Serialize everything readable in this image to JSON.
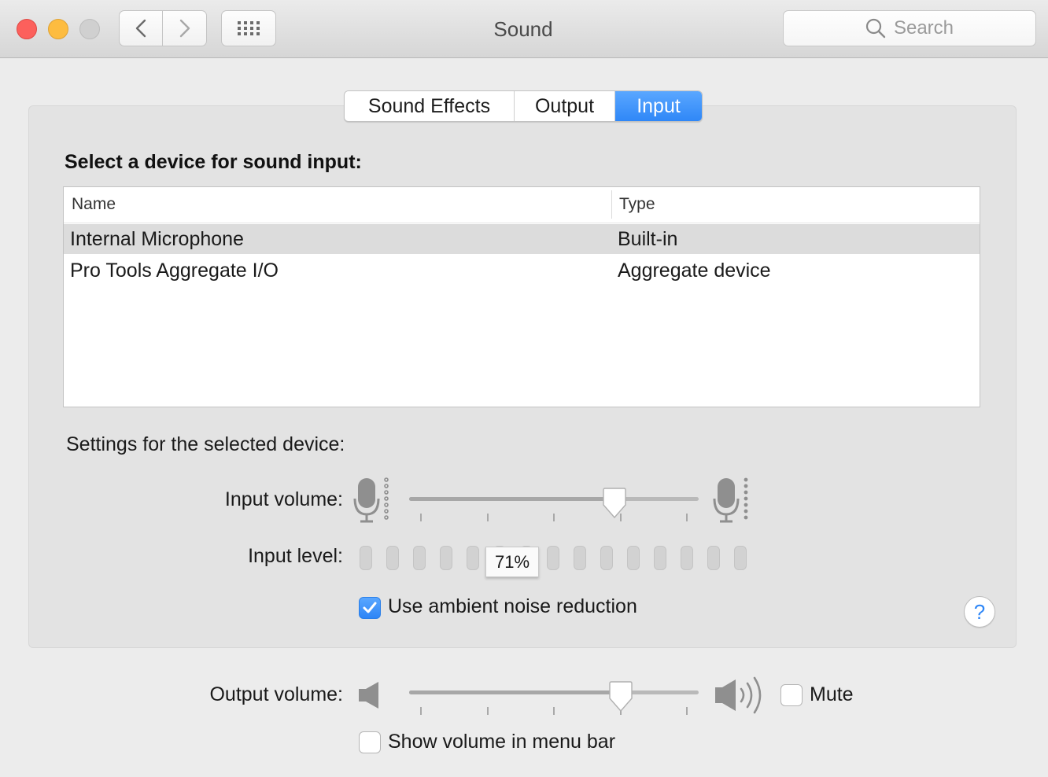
{
  "window": {
    "title": "Sound"
  },
  "toolbar": {
    "search_placeholder": "Search",
    "back_icon": "chevron-left-icon",
    "forward_icon": "chevron-right-icon",
    "grid_icon": "grid-icon"
  },
  "tabs": [
    {
      "label": "Sound Effects",
      "selected": false
    },
    {
      "label": "Output",
      "selected": false
    },
    {
      "label": "Input",
      "selected": true
    }
  ],
  "input": {
    "heading": "Select a device for sound input:",
    "columns": {
      "name": "Name",
      "type": "Type"
    },
    "devices": [
      {
        "name": "Internal Microphone",
        "type": "Built-in",
        "selected": true
      },
      {
        "name": "Pro Tools Aggregate I/O",
        "type": "Aggregate device",
        "selected": false
      }
    ],
    "settings_heading": "Settings for the selected device:",
    "volume_label": "Input volume:",
    "volume_fraction": 0.71,
    "level_label": "Input level:",
    "level_tooltip": "71%",
    "level_segments": 15,
    "ambient_label": "Use ambient noise reduction",
    "ambient_checked": true
  },
  "help": {
    "label": "?"
  },
  "output": {
    "volume_label": "Output volume:",
    "volume_fraction": 0.73,
    "mute_label": "Mute",
    "mute_checked": false,
    "menu_bar_label": "Show volume in menu bar",
    "menu_bar_checked": false
  },
  "colors": {
    "accent": "#2f87f7",
    "close": "#fc605c",
    "minimize": "#fdbc40"
  }
}
